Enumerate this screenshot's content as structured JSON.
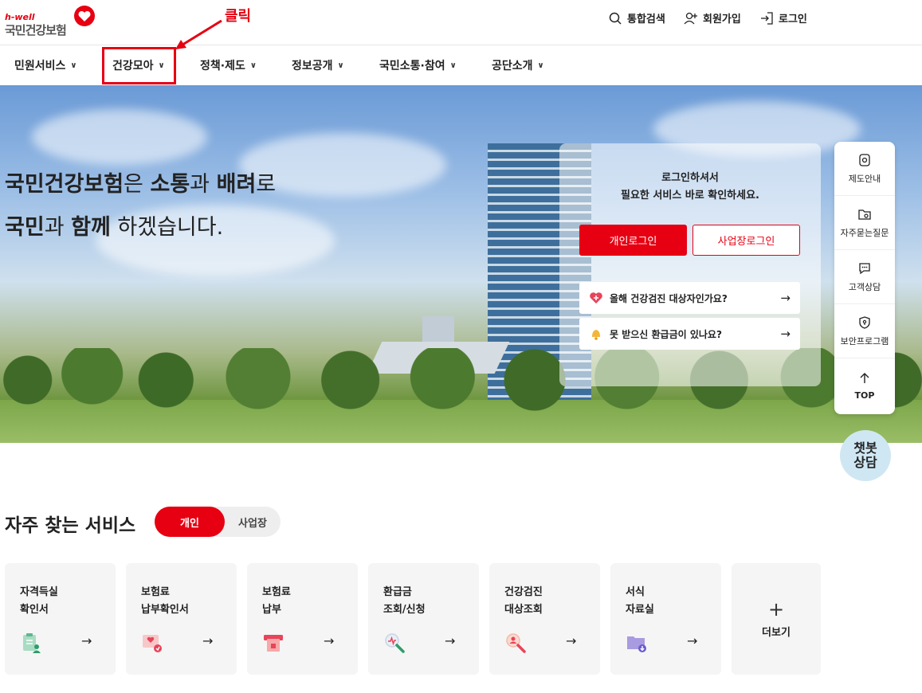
{
  "header": {
    "logo_small": "h-well",
    "logo_text": "국민건강보험",
    "utils": [
      {
        "label": "통합검색",
        "icon": "search-icon"
      },
      {
        "label": "회원가입",
        "icon": "user-plus-icon"
      },
      {
        "label": "로그인",
        "icon": "login-icon"
      }
    ],
    "annotation": "클릭"
  },
  "nav": {
    "items": [
      {
        "label": "민원서비스"
      },
      {
        "label": "건강모아"
      },
      {
        "label": "정책·제도"
      },
      {
        "label": "정보공개"
      },
      {
        "label": "국민소통·참여"
      },
      {
        "label": "공단소개"
      }
    ]
  },
  "hero": {
    "line1_a": "국민건강보험",
    "line1_b": "은 ",
    "line1_c": "소통",
    "line1_d": "과 ",
    "line1_e": "배려",
    "line1_f": "로",
    "line2_a": "국민",
    "line2_b": "과 ",
    "line2_c": "함께",
    "line2_d": " 하겠습니다."
  },
  "login": {
    "msg1": "로그인하셔서",
    "msg2": "필요한 서비스 바로 확인하세요.",
    "personal_btn": "개인로그인",
    "business_btn": "사업장로그인",
    "rows": [
      {
        "label": "올해 건강검진 대상자인가요?",
        "icon": "heart-check-icon"
      },
      {
        "label": "못 받으신 환급금이 있나요?",
        "icon": "bell-icon"
      }
    ]
  },
  "quick_menu": [
    {
      "label": "제도안내",
      "icon": "guide-icon"
    },
    {
      "label": "자주묻는질문",
      "icon": "faq-folder-icon"
    },
    {
      "label": "고객상담",
      "icon": "chat-icon"
    },
    {
      "label": "보안프로그램",
      "icon": "shield-icon"
    },
    {
      "label": "TOP",
      "icon": "arrow-up-icon"
    }
  ],
  "chatbot": {
    "line1": "챗봇",
    "line2": "상담"
  },
  "services": {
    "title": "자주 찾는 서비스",
    "toggle_on": "개인",
    "toggle_off": "사업장",
    "cards": [
      {
        "title": "자격득실\n확인서",
        "icon": "document-person-icon"
      },
      {
        "title": "보험료\n납부확인서",
        "icon": "heart-card-icon"
      },
      {
        "title": "보험료\n납부",
        "icon": "payment-icon"
      },
      {
        "title": "환급금\n조회/신청",
        "icon": "magnifier-icon"
      },
      {
        "title": "건강검진\n대상조회",
        "icon": "person-search-icon"
      },
      {
        "title": "서식\n자료실",
        "icon": "folder-download-icon"
      }
    ],
    "more": "더보기"
  },
  "colors": {
    "accent": "#e60012",
    "card_bg": "#f5f5f5"
  }
}
